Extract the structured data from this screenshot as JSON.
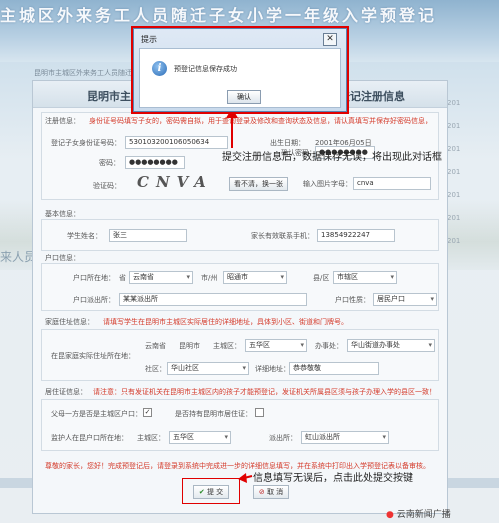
{
  "background": {
    "banner_title": "主城区外来务工人员随迁子女小学一年级入学预登记",
    "left_text": "来人员",
    "right_col": [
      "201",
      "201",
      "201",
      "201",
      "201",
      "201",
      "201"
    ],
    "breadcrumb": "昆明市主城区外来务工人员随迁子..."
  },
  "window": {
    "title_left": "昆明市主城",
    "title_right": "登记注册信息"
  },
  "login_info": {
    "section_label": "注册信息：",
    "note": "身份证号码填写子女的，密码需自拟，用于查询登录及修改和查询状态及信息，请认真填写并保存好密码信息，登记后可用于...",
    "id_label": "登记子女身份证号码：",
    "id_value": "530103200106050634",
    "birth_label": "出生日期：",
    "birth_value": "2001年06月05日",
    "password_label": "密码：",
    "password_value": "●●●●●●●●",
    "confirm_label": "确认密码：",
    "confirm_value": "●●●●●●●●",
    "captcha_label": "验证码：",
    "captcha_text": "CNVA",
    "refresh_label": "看不清，换一张",
    "captcha_input_label": "输入图片字母：",
    "captcha_input_value": "cnva"
  },
  "basic_info": {
    "section_label": "基本信息：",
    "name_label": "学生姓名：",
    "name_value": "张三",
    "phone_label": "家长有效联系手机：",
    "phone_value": "13854922247"
  },
  "hukou": {
    "section_label": "户口信息：",
    "location_label": "户口所在地：",
    "province_prefix": "省",
    "province_value": "云南省",
    "city_prefix": "市/州",
    "city_value": "昭通市",
    "county_prefix": "县/区",
    "county_value": "市辖区",
    "police_label": "户口派出所：",
    "police_value": "某某派出所",
    "nature_label": "户口性质：",
    "nature_value": "居民户口"
  },
  "address": {
    "section_label": "家庭住址信息：",
    "note": "请填写学生在昆明市主城区实际居住的详细地址，具体到小区、街道和门牌号。",
    "label": "在昆家庭实际住址所在地：",
    "province": "云南省",
    "city": "昆明市",
    "district_prefix": "主城区：",
    "district_value": "五华区",
    "office_prefix": "办事处：",
    "office_value": "华山街道办事处",
    "community_prefix": "社区：",
    "community_value": "华山社区",
    "detail_prefix": "详细地址：",
    "detail_value": "恭恭敬敬"
  },
  "residence": {
    "section_label": "居住证信息：",
    "note": "请注意：只有发证机关在昆明市主城区内的孩子才能预登记，发证机关所属县区须与孩子办理入学的县区一致！！",
    "parent_label": "父母一方是否是主城区户口：",
    "parent_checked": "✓",
    "permit_label": "是否持有昆明市居住证：",
    "guardian_label": "监护人在昆户口所在地：",
    "district_prefix": "主城区：",
    "district_value": "五华区",
    "police_prefix": "派出所：",
    "police_value": "虹山派出所"
  },
  "footer": {
    "note": "尊敬的家长，您好！完成预登记后，请登录到系统中完成进一步的详细信息填写，并在系统中打印出入学预登记表以备审核。",
    "submit_label": "提 交",
    "cancel_label": "取 消"
  },
  "dialog": {
    "title": "提示",
    "close": "✕",
    "icon_glyph": "i",
    "message": "预登记信息保存成功",
    "ok_label": "确认"
  },
  "annotations": {
    "dialog_note": "提交注册信息后，数据保存无误，将出现此对话框",
    "submit_note": "信息填写无误后，点击此处提交按键"
  },
  "watermark": {
    "dot": "●",
    "text": "云南新闻广播"
  },
  "colors": {
    "annotation_red": "#e00000",
    "note_red": "#d43a2a",
    "dialog_border": "#5b83b0"
  }
}
